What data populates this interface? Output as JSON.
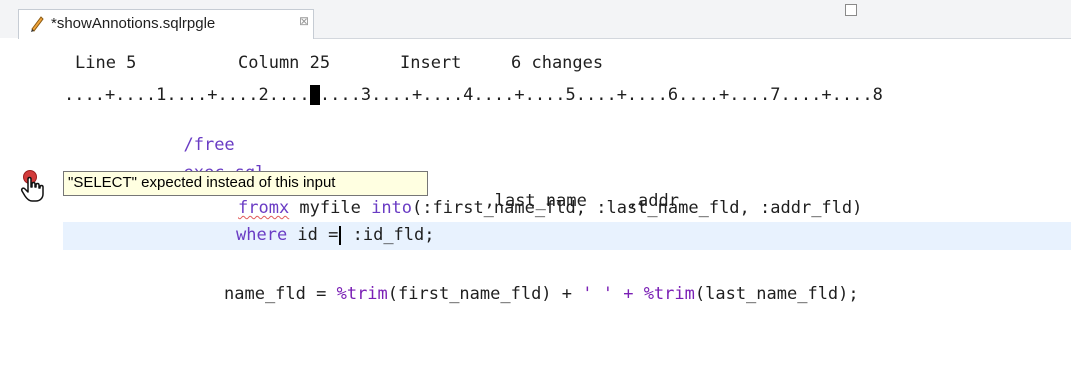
{
  "editor": {
    "tab": {
      "title": "*showAnnotions.sqlrpgle",
      "close_symbol": "⊠",
      "icon": "pencil-icon"
    },
    "status": {
      "line": "Line 5",
      "column": "Column 25",
      "mode": "Insert",
      "changes": "6 changes"
    },
    "ruler": {
      "text_before": "....+....1....+....2....",
      "cursor_char": "+",
      "text_after": "....3....+....4....+....5....+....6....+....7....+....8"
    },
    "code": {
      "line1": "/free",
      "line2": "exec sql",
      "line3": ",last_name    ,addr",
      "line4_keyword": "fromx",
      "line4_a": " myfile ",
      "line4_into": "into",
      "line4_b": "(:first_name_fld, :last_name_fld, :addr_fld)",
      "line5_where": "where",
      "line5_a": " id =",
      "line5_b": " :id_fld;",
      "line6_a": "name_fld = ",
      "line6_trim1": "%trim",
      "line6_b": "(first_name_fld) + ",
      "line6_quote": "' '",
      "line6_plus": " + ",
      "line6_trim2": "%trim",
      "line6_c": "(last_name_fld);"
    },
    "tooltip": {
      "text": "\"SELECT\" expected instead of this input"
    }
  }
}
